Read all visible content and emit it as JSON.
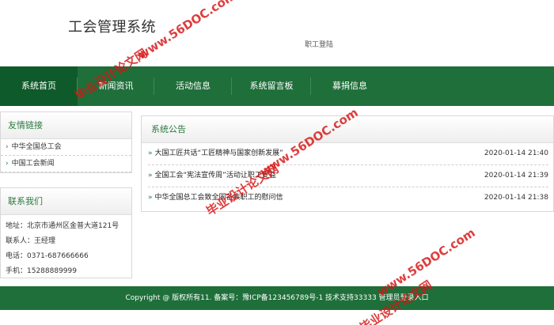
{
  "header": {
    "site_title": "工会管理系统",
    "login_label": "职工登陆"
  },
  "nav": {
    "items": [
      "系统首页",
      "新闻资讯",
      "活动信息",
      "系统留言板",
      "募捐信息"
    ]
  },
  "friends": {
    "title": "友情链接",
    "items": [
      "中华全国总工会",
      "中国工会新闻"
    ]
  },
  "contact": {
    "title": "联系我们",
    "address": "地址：北京市通州区金普大道121号",
    "person": "联系人：王经理",
    "phone": "电话：0371-687666666",
    "mobile": "手机：15288889999"
  },
  "notices": {
    "title": "系统公告",
    "items": [
      {
        "title": "大国工匠共话“工匠精神与国家创新发展”",
        "date": "2020-01-14 21:40"
      },
      {
        "title": "全国工会“宪法宣传周”活动让职工受益",
        "date": "2020-01-14 21:39"
      },
      {
        "title": "中华全国总工会致全国各族职工的慰问信",
        "date": "2020-01-14 21:38"
      }
    ]
  },
  "footer": {
    "text": "Copyright @ 版权所有11. 备案号：豫ICP备123456789号-1   技术支持33333    管理员登录入口"
  },
  "watermarks": [
    "毕业设计论文网",
    "www.56DOC.com"
  ],
  "colors": {
    "nav_green": "#1f6f3a",
    "accent_green": "#2a7a3e",
    "watermark_red": "#d71414"
  }
}
